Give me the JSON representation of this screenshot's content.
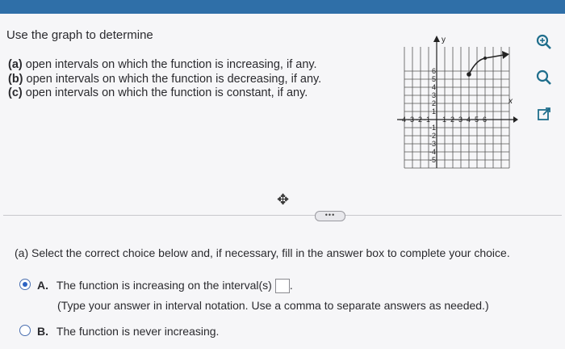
{
  "question": {
    "title": "Use the graph to determine",
    "parts": [
      {
        "letter": "(a)",
        "text": "open intervals on which the function is increasing, if any."
      },
      {
        "letter": "(b)",
        "text": "open intervals on which the function is decreasing, if any."
      },
      {
        "letter": "(c)",
        "text": "open intervals on which the function is constant, if any."
      }
    ]
  },
  "graph": {
    "y_axis_label": "y",
    "x_axis_label": "x",
    "x_ticks": [
      "-4",
      "-3",
      "-2",
      "-1",
      "1",
      "2",
      "3",
      "4",
      "5",
      "6"
    ],
    "y_ticks": [
      "6",
      "5",
      "4",
      "3",
      "2",
      "1",
      "-1",
      "-2",
      "-3",
      "-4",
      "-5"
    ]
  },
  "tools": {
    "zoom_in_icon": "zoom-in-icon",
    "zoom_out_icon": "zoom-out-icon",
    "popout_icon": "popout-icon"
  },
  "more_button_label": "•••",
  "part_a": {
    "prompt": "(a) Select the correct choice below and, if necessary, fill in the answer box to complete your choice.",
    "choices": [
      {
        "letter": "A.",
        "text": "The function is increasing on the interval(s)",
        "hint": "(Type your answer in interval notation. Use a comma to separate answers as needed.)",
        "selected": true
      },
      {
        "letter": "B.",
        "text": "The function is never increasing.",
        "selected": false
      }
    ]
  },
  "colors": {
    "topbar": "#2f6fa8",
    "accent": "#2c63c3",
    "icon_teal": "#1f6e8c"
  }
}
